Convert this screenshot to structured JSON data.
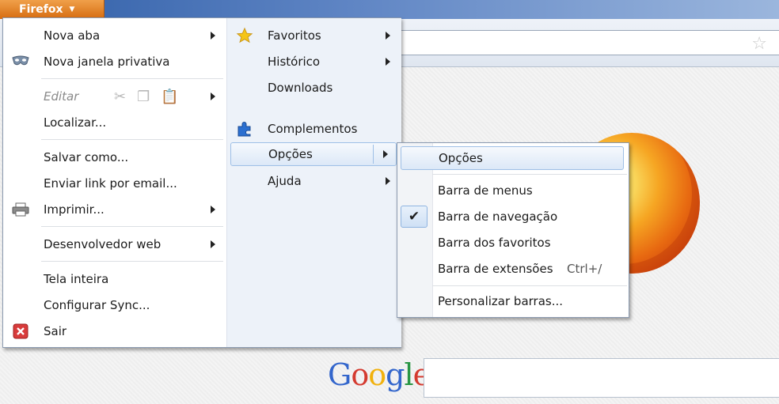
{
  "titlebar": {
    "app_button": "Firefox"
  },
  "main_menu": {
    "left": [
      {
        "label": "Nova aba",
        "submenu": true
      },
      {
        "label": "Nova janela privativa",
        "icon": "private-mask-icon"
      },
      {
        "label": "Editar",
        "disabled": true,
        "submenu": true
      },
      {
        "label": "Localizar..."
      },
      {
        "label": "Salvar como..."
      },
      {
        "label": "Enviar link por email..."
      },
      {
        "label": "Imprimir...",
        "icon": "printer-icon",
        "submenu": true
      },
      {
        "label": "Desenvolvedor web",
        "submenu": true
      },
      {
        "label": "Tela inteira"
      },
      {
        "label": "Configurar Sync..."
      },
      {
        "label": "Sair",
        "icon": "close-icon"
      }
    ],
    "right": [
      {
        "label": "Favoritos",
        "icon": "star-icon",
        "submenu": true
      },
      {
        "label": "Histórico",
        "submenu": true
      },
      {
        "label": "Downloads"
      },
      {
        "label": "Complementos",
        "icon": "puzzle-icon"
      },
      {
        "label": "Opções",
        "submenu": true,
        "highlighted": true
      },
      {
        "label": "Ajuda",
        "submenu": true
      }
    ]
  },
  "submenu_opcoes": {
    "items": [
      {
        "label": "Opções",
        "highlighted": true
      },
      {
        "label": "Barra de menus"
      },
      {
        "label": "Barra de navegação",
        "checked": true
      },
      {
        "label": "Barra dos favoritos"
      },
      {
        "label": "Barra de extensões",
        "shortcut": "Ctrl+/"
      },
      {
        "label": "Personalizar barras..."
      }
    ]
  },
  "page": {
    "google_logo": "Google",
    "search_placeholder": ""
  },
  "colors": {
    "firefox_orange": "#e0801f",
    "titlebar_blue": "#2f5ea7",
    "highlight_border": "#9ebfe6"
  }
}
